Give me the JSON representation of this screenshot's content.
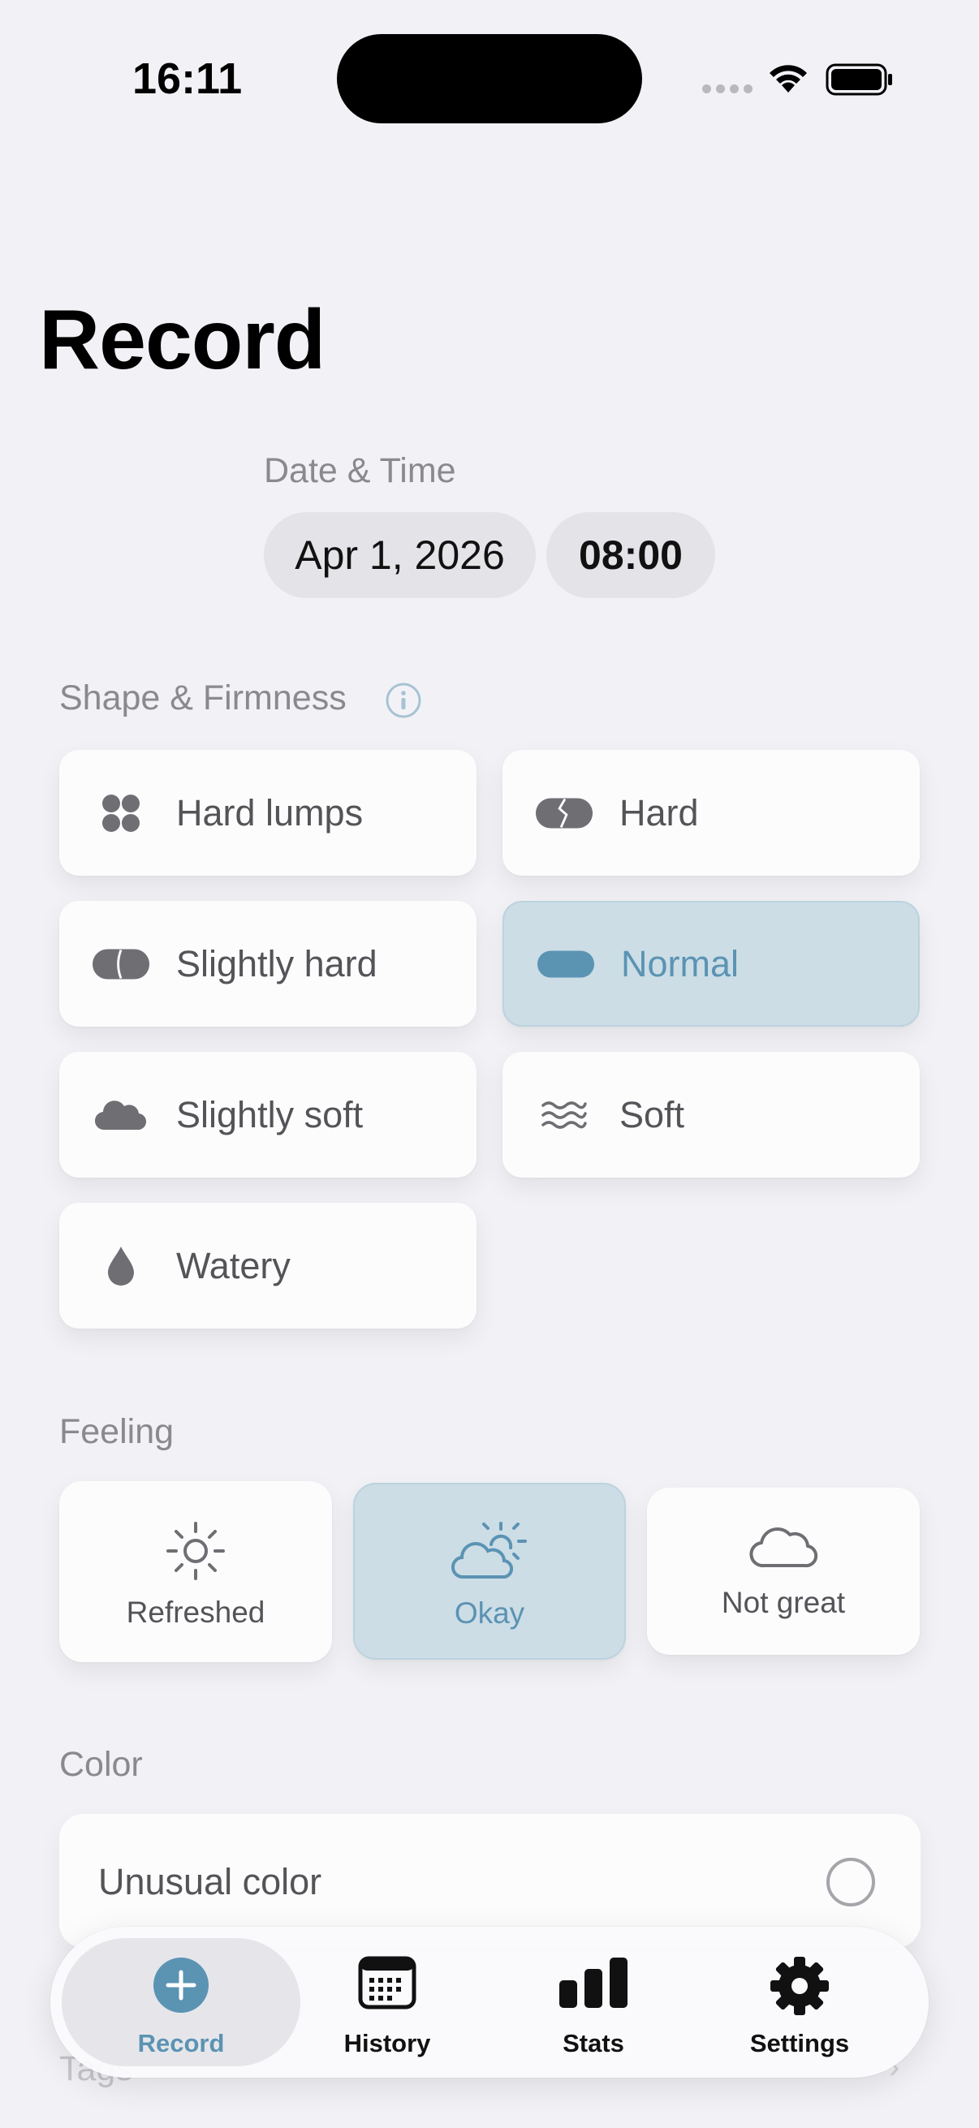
{
  "status_bar": {
    "time": "16:11"
  },
  "page_title": "Record",
  "date_time": {
    "label": "Date & Time",
    "date": "Apr 1, 2026",
    "time": "08:00"
  },
  "shape": {
    "label": "Shape & Firmness",
    "options": [
      {
        "label": "Hard lumps",
        "icon": "lumps-icon",
        "selected": false
      },
      {
        "label": "Hard",
        "icon": "hard-icon",
        "selected": false
      },
      {
        "label": "Slightly hard",
        "icon": "slightly-hard-icon",
        "selected": false
      },
      {
        "label": "Normal",
        "icon": "normal-icon",
        "selected": true
      },
      {
        "label": "Slightly soft",
        "icon": "cloud-icon",
        "selected": false
      },
      {
        "label": "Soft",
        "icon": "waves-icon",
        "selected": false
      },
      {
        "label": "Watery",
        "icon": "drop-icon",
        "selected": false
      }
    ]
  },
  "feeling": {
    "label": "Feeling",
    "options": [
      {
        "label": "Refreshed",
        "icon": "sun-icon",
        "selected": false
      },
      {
        "label": "Okay",
        "icon": "cloud-sun-icon",
        "selected": true
      },
      {
        "label": "Not great",
        "icon": "cloud-icon",
        "selected": false
      }
    ]
  },
  "color": {
    "label": "Color",
    "option_label": "Unusual color",
    "checked": false
  },
  "tags_label": "Tags",
  "tabbar": {
    "tabs": [
      {
        "label": "Record",
        "icon": "plus-circle-icon",
        "active": true
      },
      {
        "label": "History",
        "icon": "calendar-icon",
        "active": false
      },
      {
        "label": "Stats",
        "icon": "bar-chart-icon",
        "active": false
      },
      {
        "label": "Settings",
        "icon": "gear-icon",
        "active": false
      }
    ]
  },
  "colors": {
    "accent": "#5b93b3",
    "selected_bg": "#ccdde6",
    "background": "#f2f2f6",
    "icon_gray": "#6e6e73"
  }
}
